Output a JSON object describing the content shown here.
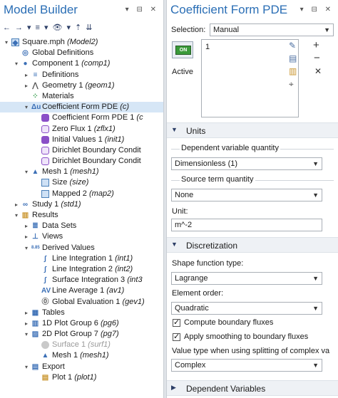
{
  "left": {
    "title": "Model Builder",
    "title_controls": "▾ ⊟ ✕",
    "toolbar": [
      "←",
      "→",
      "▾",
      "≡",
      "▾",
      "👁",
      "▾",
      "⇡",
      "⇊"
    ],
    "tree": [
      {
        "label": "Square.mph",
        "tag": "(Model2)",
        "level": 0,
        "arrow": "▾",
        "icon": "model"
      },
      {
        "label": "Global Definitions",
        "tag": "",
        "level": 1,
        "arrow": "",
        "icon": "globe"
      },
      {
        "label": "Component 1",
        "tag": "(comp1)",
        "level": 1,
        "arrow": "▾",
        "icon": "component"
      },
      {
        "label": "Definitions",
        "tag": "",
        "level": 2,
        "arrow": "▸",
        "icon": "definitions"
      },
      {
        "label": "Geometry 1",
        "tag": "(geom1)",
        "level": 2,
        "arrow": "▸",
        "icon": "geometry"
      },
      {
        "label": "Materials",
        "tag": "",
        "level": 2,
        "arrow": "",
        "icon": "materials"
      },
      {
        "label": "Coefficient Form PDE",
        "tag": "(c)",
        "level": 2,
        "arrow": "▾",
        "icon": "pde",
        "selected": true
      },
      {
        "label": "Coefficient Form PDE 1",
        "tag": "(c",
        "level": 3,
        "arrow": "",
        "icon": "purple"
      },
      {
        "label": "Zero Flux 1",
        "tag": "(zflx1)",
        "level": 3,
        "arrow": "",
        "icon": "purple-o"
      },
      {
        "label": "Initial Values 1",
        "tag": "(init1)",
        "level": 3,
        "arrow": "",
        "icon": "purple"
      },
      {
        "label": "Dirichlet Boundary Condit",
        "tag": "",
        "level": 3,
        "arrow": "",
        "icon": "purple-o"
      },
      {
        "label": "Dirichlet Boundary Condit",
        "tag": "",
        "level": 3,
        "arrow": "",
        "icon": "purple-o"
      },
      {
        "label": "Mesh 1",
        "tag": "(mesh1)",
        "level": 2,
        "arrow": "▾",
        "icon": "mesh"
      },
      {
        "label": "Size",
        "tag": "(size)",
        "level": 3,
        "arrow": "",
        "icon": "size"
      },
      {
        "label": "Mapped 2",
        "tag": "(map2)",
        "level": 3,
        "arrow": "",
        "icon": "mapped"
      },
      {
        "label": "Study 1",
        "tag": "(std1)",
        "level": 1,
        "arrow": "▸",
        "icon": "study"
      },
      {
        "label": "Results",
        "tag": "",
        "level": 1,
        "arrow": "▾",
        "icon": "results"
      },
      {
        "label": "Data Sets",
        "tag": "",
        "level": 2,
        "arrow": "▸",
        "icon": "datasets"
      },
      {
        "label": "Views",
        "tag": "",
        "level": 2,
        "arrow": "▸",
        "icon": "views"
      },
      {
        "label": "Derived Values",
        "tag": "",
        "level": 2,
        "arrow": "▾",
        "icon": "derived"
      },
      {
        "label": "Line Integration 1",
        "tag": "(int1)",
        "level": 3,
        "arrow": "",
        "icon": "integral"
      },
      {
        "label": "Line Integration 2",
        "tag": "(int2)",
        "level": 3,
        "arrow": "",
        "icon": "integral"
      },
      {
        "label": "Surface Integration 3",
        "tag": "(int3",
        "level": 3,
        "arrow": "",
        "icon": "integral"
      },
      {
        "label": "Line Average 1",
        "tag": "(av1)",
        "level": 3,
        "arrow": "",
        "icon": "average"
      },
      {
        "label": "Global Evaluation 1",
        "tag": "(gev1)",
        "level": 3,
        "arrow": "",
        "icon": "global-eval"
      },
      {
        "label": "Tables",
        "tag": "",
        "level": 2,
        "arrow": "▸",
        "icon": "tables"
      },
      {
        "label": "1D Plot Group 6",
        "tag": "(pg6)",
        "level": 2,
        "arrow": "▸",
        "icon": "plot1d"
      },
      {
        "label": "2D Plot Group 7",
        "tag": "(pg7)",
        "level": 2,
        "arrow": "▾",
        "icon": "plot2d"
      },
      {
        "label": "Surface 1",
        "tag": "(surf1)",
        "level": 3,
        "arrow": "",
        "icon": "surface",
        "dim": true
      },
      {
        "label": "Mesh 1",
        "tag": "(mesh1)",
        "level": 3,
        "arrow": "",
        "icon": "mesh-plot"
      },
      {
        "label": "Export",
        "tag": "",
        "level": 2,
        "arrow": "▾",
        "icon": "export"
      },
      {
        "label": "Plot 1",
        "tag": "(plot1)",
        "level": 3,
        "arrow": "",
        "icon": "plot-export"
      }
    ]
  },
  "right": {
    "title": "Coefficient Form PDE",
    "title_controls": "▾ ⊟ ✕",
    "selection_label": "Selection:",
    "selection_value": "Manual",
    "active_badge": "ON",
    "active_label": "Active",
    "selection_list": [
      "1"
    ],
    "units_title": "Units",
    "dep_var_label": "Dependent variable quantity",
    "dep_var_value": "Dimensionless (1)",
    "source_label": "Source term quantity",
    "source_value": "None",
    "unit_label": "Unit:",
    "unit_value": "m^-2",
    "discretization_title": "Discretization",
    "shape_label": "Shape function type:",
    "shape_value": "Lagrange",
    "order_label": "Element order:",
    "order_value": "Quadratic",
    "check1": "Compute boundary fluxes",
    "check2": "Apply smoothing to boundary fluxes",
    "split_label": "Value type when using splitting of complex va",
    "split_value": "Complex",
    "depvars_title": "Dependent Variables",
    "side_icons": [
      "✎",
      "+",
      "▤",
      "−",
      "▥",
      "✕",
      "⌖"
    ]
  }
}
